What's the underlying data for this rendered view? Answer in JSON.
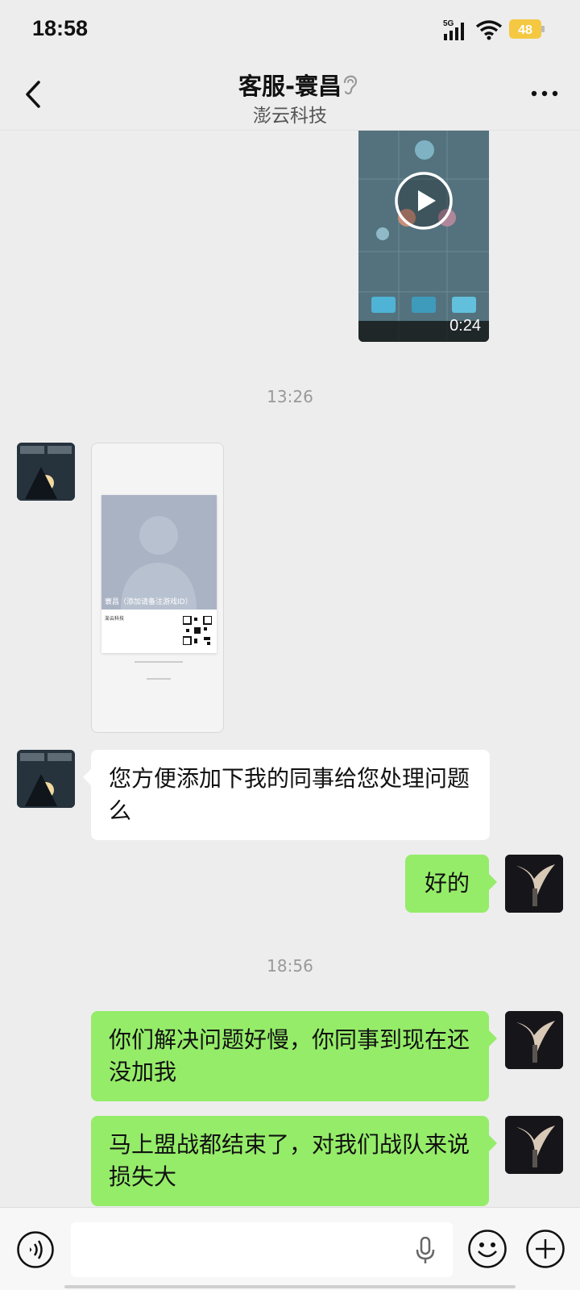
{
  "status_bar": {
    "time": "18:58",
    "network": "5G",
    "battery": "48"
  },
  "header": {
    "title": "客服-寰昌",
    "subtitle": "澎云科技",
    "icons": [
      "back-icon",
      "ear-icon",
      "more-icon"
    ]
  },
  "messages": {
    "video": {
      "duration": "0:24"
    },
    "time1": "13:26",
    "card": {
      "caption": "寰昌（添加请备注游戏ID）",
      "company": "澎云科技"
    },
    "msg1": "您方便添加下我的同事给您处理问题么",
    "msg2": "好的",
    "time2": "18:56",
    "msg3": "你们解决问题好慢，你同事到现在还没加我",
    "msg4": "马上盟战都结束了，对我们战队来说损失大"
  },
  "input_bar": {
    "placeholder": "",
    "icons": [
      "voice-icon",
      "mic-icon",
      "emoji-icon",
      "plus-icon"
    ]
  },
  "colors": {
    "background": "#ededed",
    "my_bubble": "#95ec69",
    "their_bubble": "#ffffff"
  }
}
